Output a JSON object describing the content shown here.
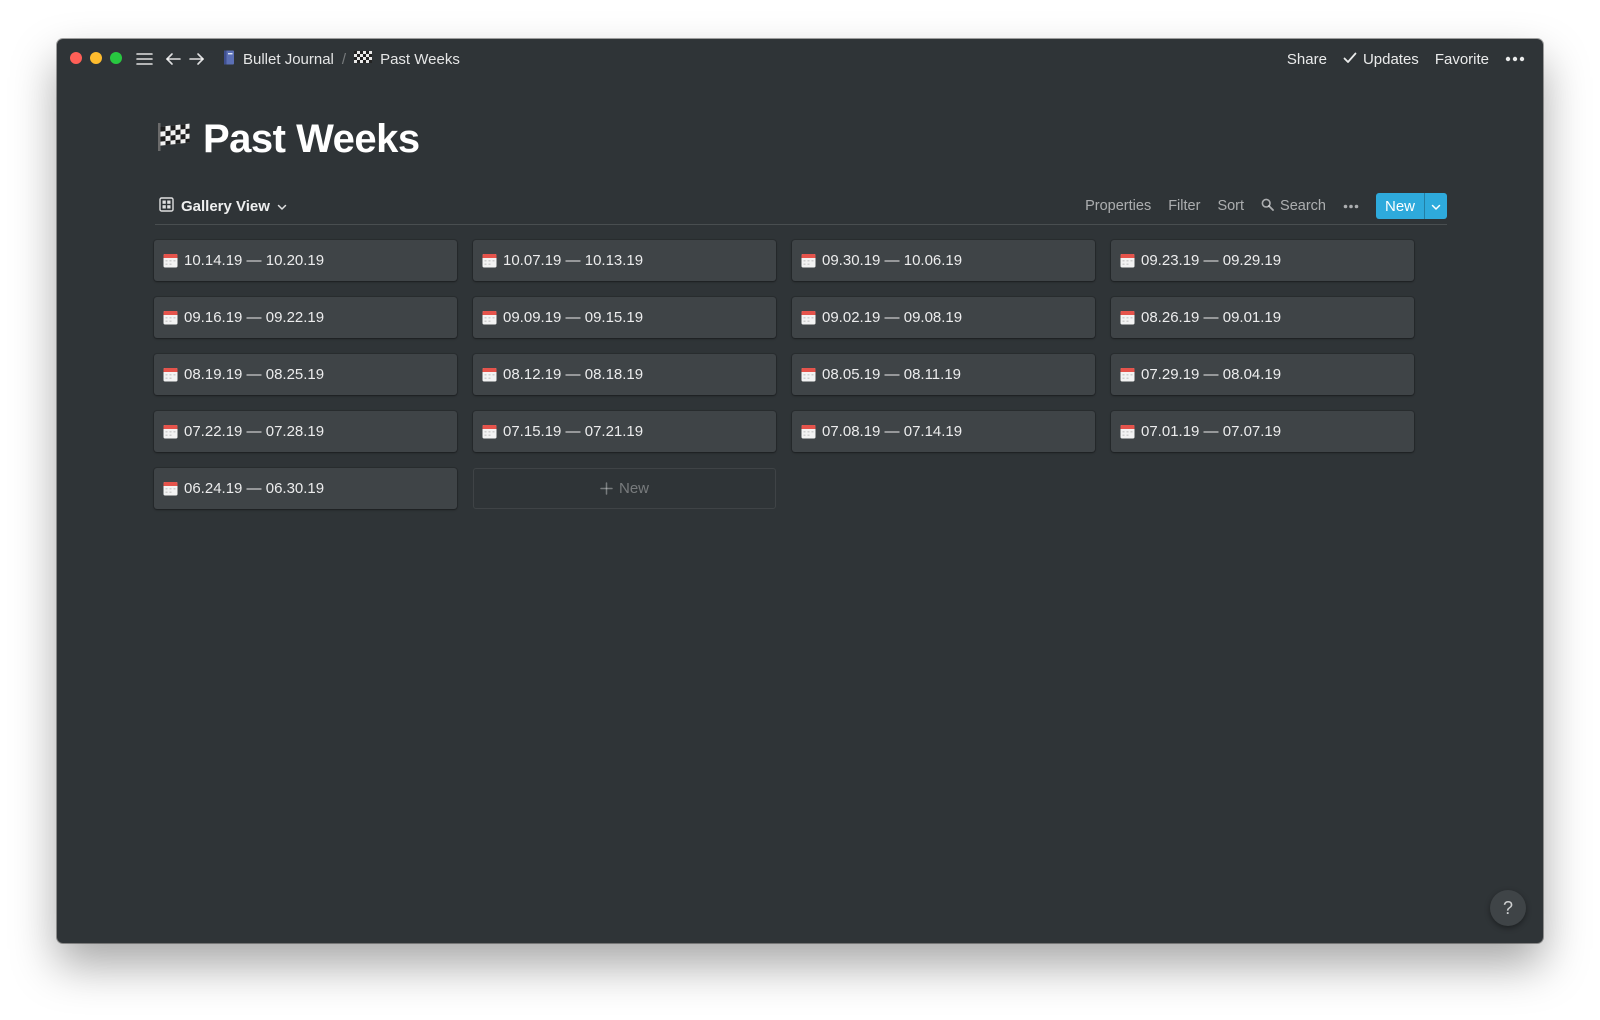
{
  "titlebar": {
    "breadcrumbs": [
      {
        "label": "Bullet Journal",
        "icon": "notebook-icon"
      },
      {
        "label": "Past Weeks",
        "icon": "checkered-flag-icon"
      }
    ],
    "share_label": "Share",
    "updates_label": "Updates",
    "favorite_label": "Favorite"
  },
  "page": {
    "title": "Past Weeks",
    "icon": "checkered-flag-icon"
  },
  "view_bar": {
    "view_label": "Gallery View",
    "properties_label": "Properties",
    "filter_label": "Filter",
    "sort_label": "Sort",
    "search_label": "Search",
    "new_label": "New"
  },
  "gallery": {
    "cards": [
      {
        "title": "10.14.19 — 10.20.19",
        "icon": "calendar-icon"
      },
      {
        "title": "10.07.19 — 10.13.19",
        "icon": "calendar-icon"
      },
      {
        "title": "09.30.19 — 10.06.19",
        "icon": "calendar-icon"
      },
      {
        "title": "09.23.19 — 09.29.19",
        "icon": "calendar-icon"
      },
      {
        "title": "09.16.19 — 09.22.19",
        "icon": "calendar-icon"
      },
      {
        "title": "09.09.19 — 09.15.19",
        "icon": "calendar-icon"
      },
      {
        "title": "09.02.19 — 09.08.19",
        "icon": "calendar-icon"
      },
      {
        "title": "08.26.19 — 09.01.19",
        "icon": "calendar-icon"
      },
      {
        "title": "08.19.19 — 08.25.19",
        "icon": "calendar-icon"
      },
      {
        "title": "08.12.19 — 08.18.19",
        "icon": "calendar-icon"
      },
      {
        "title": "08.05.19 — 08.11.19",
        "icon": "calendar-icon"
      },
      {
        "title": "07.29.19 — 08.04.19",
        "icon": "calendar-icon"
      },
      {
        "title": "07.22.19 — 07.28.19",
        "icon": "calendar-icon"
      },
      {
        "title": "07.15.19 — 07.21.19",
        "icon": "calendar-icon"
      },
      {
        "title": "07.08.19 — 07.14.19",
        "icon": "calendar-icon"
      },
      {
        "title": "07.01.19 — 07.07.19",
        "icon": "calendar-icon"
      },
      {
        "title": "06.24.19 — 06.30.19",
        "icon": "calendar-icon"
      }
    ],
    "new_card_label": "New"
  },
  "help_label": "?",
  "colors": {
    "background": "#2f3437",
    "card": "#3f4447",
    "accent": "#2eaadc"
  }
}
